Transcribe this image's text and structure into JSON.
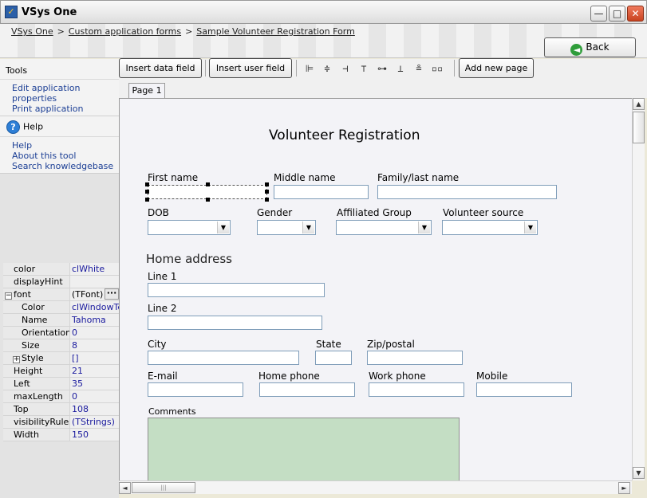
{
  "window": {
    "title": "VSys One",
    "min_glyph": "—",
    "max_glyph": "□",
    "close_glyph": "✕"
  },
  "breadcrumb": {
    "items": [
      "VSys One",
      "Custom application forms",
      "Sample Volunteer Registration Form"
    ],
    "separator": ">"
  },
  "header": {
    "back_label": "Back"
  },
  "left_panel": {
    "tools_title": "Tools",
    "tools_links": [
      "Edit application properties",
      "Print application"
    ],
    "help_title": "Help",
    "help_links": [
      "Help",
      "About this tool",
      "Search knowledgebase"
    ]
  },
  "properties": [
    {
      "name": "color",
      "value": "clWhite"
    },
    {
      "name": "displayHint",
      "value": ""
    },
    {
      "name": "font",
      "value": "(TFont)",
      "expander": "⊟"
    },
    {
      "name": "Color",
      "value": "clWindowTe:"
    },
    {
      "name": "Name",
      "value": "Tahoma"
    },
    {
      "name": "Orientation",
      "value": "0"
    },
    {
      "name": "Size",
      "value": "8"
    },
    {
      "name": "Style",
      "value": "[]",
      "expander": "⊞"
    },
    {
      "name": "Height",
      "value": "21"
    },
    {
      "name": "Left",
      "value": "35"
    },
    {
      "name": "maxLength",
      "value": "0"
    },
    {
      "name": "Top",
      "value": "108"
    },
    {
      "name": "visibilityRules",
      "value": "(TStrings)"
    },
    {
      "name": "Width",
      "value": "150"
    }
  ],
  "toolbar": {
    "insert_data_field": "Insert data field",
    "insert_user_field": "Insert user field",
    "add_new_page": "Add new page",
    "align_icons": [
      "align-left-icon",
      "align-center-horizontal-icon",
      "align-right-icon",
      "align-top-icon",
      "align-middle-vertical-icon",
      "align-bottom-icon",
      "space-vertically-icon",
      "space-horizontally-icon"
    ]
  },
  "tabs": {
    "page1": "Page 1"
  },
  "form": {
    "title": "Volunteer Registration",
    "first_name": "First name",
    "middle_name": "Middle name",
    "family_name": "Family/last name",
    "dob": "DOB",
    "gender": "Gender",
    "affiliated_group": "Affiliated Group",
    "volunteer_source": "Volunteer source",
    "home_address": "Home address",
    "line1": "Line 1",
    "line2": "Line 2",
    "city": "City",
    "state": "State",
    "zip": "Zip/postal",
    "email": "E-mail",
    "home_phone": "Home phone",
    "work_phone": "Work phone",
    "mobile": "Mobile",
    "comments": "Comments"
  },
  "colors": {
    "comments_fill": "#c4dec4",
    "link": "#1c3f95",
    "prop_value": "#1a1a9e"
  }
}
